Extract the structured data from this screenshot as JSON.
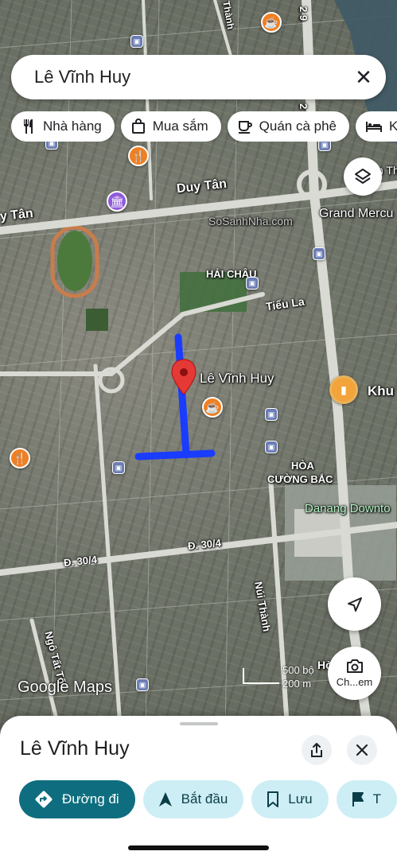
{
  "search": {
    "query": "Lê Vĩnh Huy"
  },
  "chips": [
    {
      "icon": "restaurant-icon",
      "label": "Nhà hàng"
    },
    {
      "icon": "shopping-bag-icon",
      "label": "Mua sắm"
    },
    {
      "icon": "coffee-cup-icon",
      "label": "Quán cà phê"
    },
    {
      "icon": "bed-icon",
      "label": "K"
    }
  ],
  "map": {
    "labels": {
      "duy_tan": "Duy Tân",
      "duy_tan_left": "y Tân",
      "grand_mercure": "Grand Mercu",
      "hai_chau": "HẢI CHÂU",
      "tieu_la": "Tiểu La",
      "le_vinh_huy": "Lê Vĩnh Huy",
      "khu": "Khu",
      "hoa_cuong_bac_1": "HÒA",
      "hoa_cuong_bac_2": "CƯỜNG BẮC",
      "danang_downtown": "Danang Downto",
      "d30_4_a": "Đ. 30/4",
      "d30_4_b": "Đ. 30/4",
      "nui_thanh": "Núi Thành",
      "ngo_tat_to": "Ngô Tất Tố",
      "thanh_top": "Thành",
      "street_2_9": "2 9",
      "phan_thanh": "n Th",
      "hoa_right": "Hò"
    },
    "watermark": "SoSanhNha.com",
    "scale": {
      "imperial": "500 bộ",
      "metric": "200 m"
    },
    "logo": "Google Maps",
    "street_view_label": "Ch...em"
  },
  "sheet": {
    "title": "Lê Vĩnh Huy",
    "actions": [
      {
        "icon": "directions-icon",
        "label": "Đường đi"
      },
      {
        "icon": "navigation-arrow-icon",
        "label": "Bắt đầu"
      },
      {
        "icon": "bookmark-icon",
        "label": "Lưu"
      },
      {
        "icon": "flag-icon",
        "label": "T"
      }
    ]
  },
  "colors": {
    "route": "#1a3cff",
    "pin": "#e53935",
    "primary_action": "#0e6e7f",
    "secondary_action": "#cdeef5",
    "poi_orange": "#f07f22",
    "poi_purple": "#8f5ad8"
  }
}
